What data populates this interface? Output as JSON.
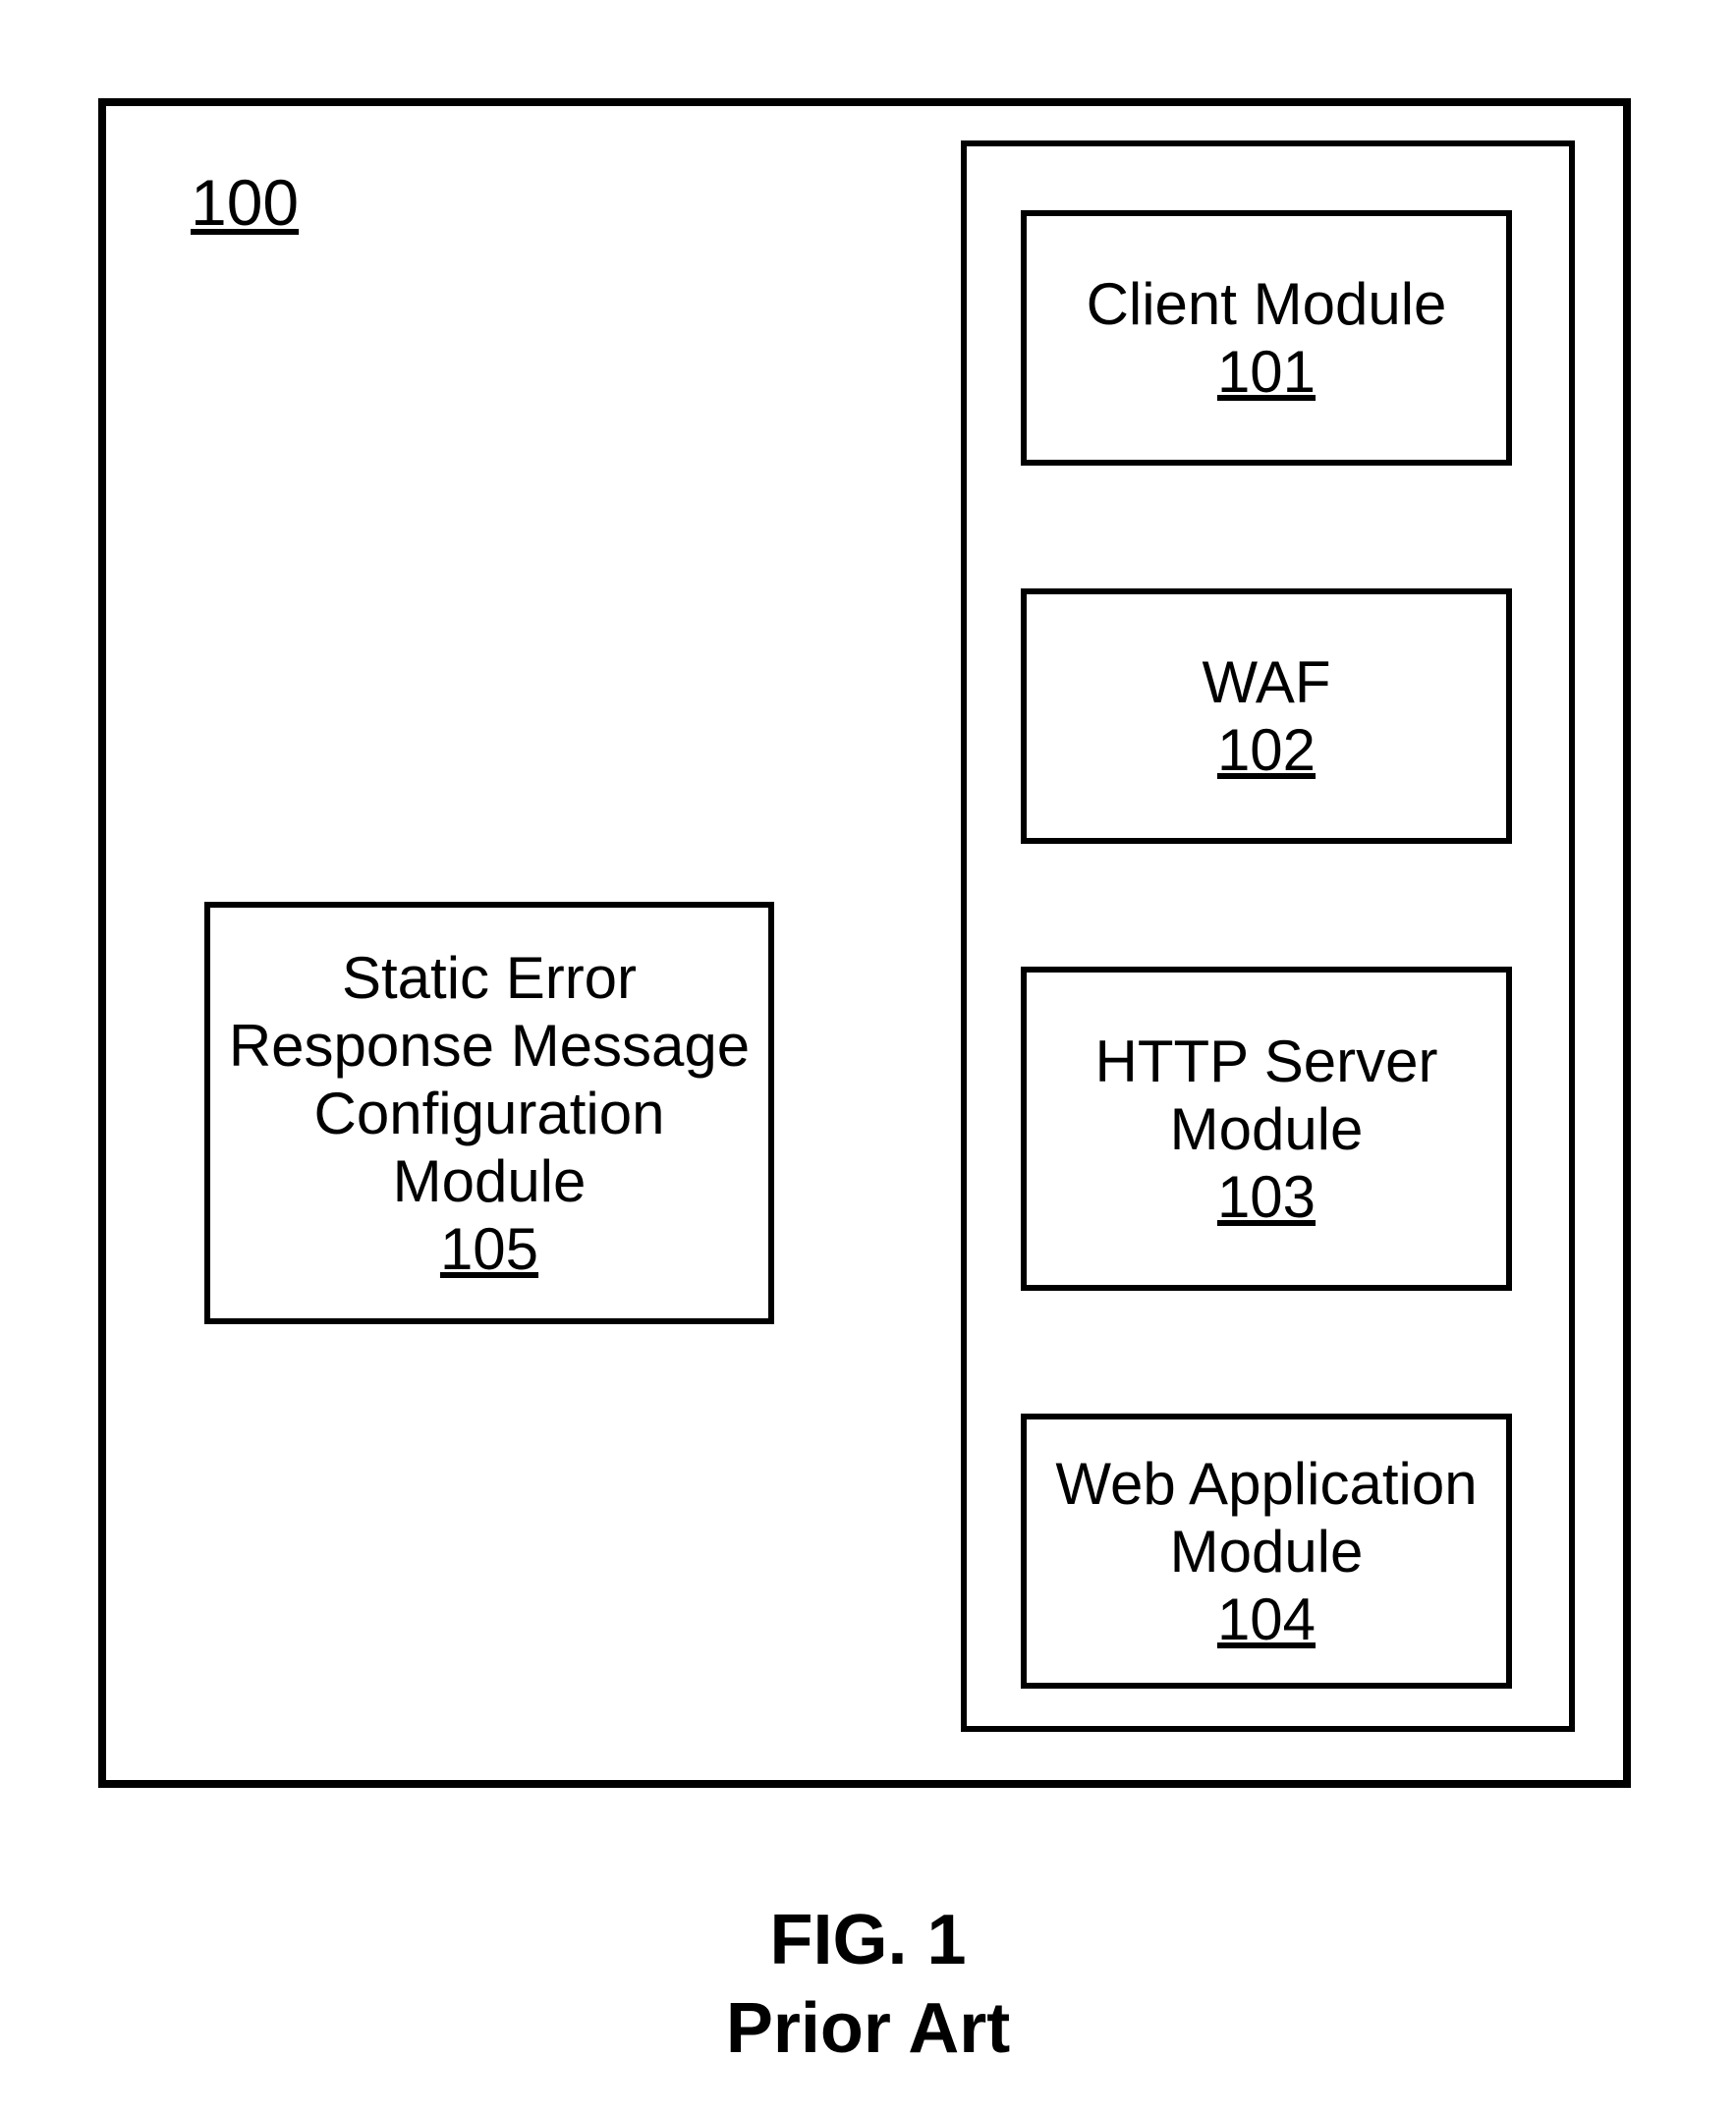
{
  "figure": {
    "ref": "100",
    "caption_line1": "FIG. 1",
    "caption_line2": "Prior Art"
  },
  "left_module": {
    "line1": "Static Error",
    "line2": "Response Message",
    "line3": "Configuration",
    "line4": "Module",
    "ref": "105"
  },
  "right_modules": {
    "m1": {
      "line1": "Client Module",
      "ref": "101"
    },
    "m2": {
      "line1": "WAF",
      "ref": "102"
    },
    "m3": {
      "line1": "HTTP Server",
      "line2": "Module",
      "ref": "103"
    },
    "m4": {
      "line1": "Web Application",
      "line2": "Module",
      "ref": "104"
    }
  }
}
